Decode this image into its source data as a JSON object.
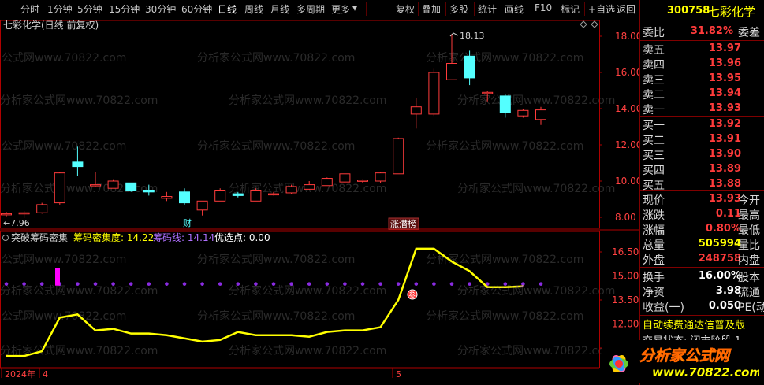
{
  "toolbar": {
    "left_items": [
      "分时",
      "1分钟",
      "5分钟",
      "15分钟",
      "30分钟",
      "60分钟",
      "日线",
      "周线",
      "月线",
      "多周期",
      "更多"
    ],
    "more_arrow": "▾",
    "active": "日线",
    "right_items": [
      "复权",
      "叠加",
      "多股",
      "统计",
      "画线",
      "F10",
      "标记",
      "+自选",
      "返回"
    ]
  },
  "chart": {
    "title": "七彩化学(日线 前复权)",
    "watermark": "分析家公式网www.70822.com",
    "price_axis": [
      "18.00",
      "16.00",
      "14.00",
      "12.00",
      "10.00",
      "8.00"
    ],
    "high_label": "18.13",
    "low_label": "7.96",
    "cai_badge": "财",
    "ztb_badge": "涨潜榜",
    "indicator": {
      "name": "突破筹码密集",
      "density_label": "筹码密集度:",
      "density_value": "14.22",
      "chip_label": "筹码线:",
      "chip_value": "14.14",
      "pick_label": "优选点:",
      "pick_value": "0.00",
      "axis": [
        "16.50",
        "15.00",
        "13.50",
        "12.00",
        "10.50"
      ],
      "signal_badge": "参"
    },
    "date_axis": [
      "2024年",
      "4",
      "5"
    ],
    "colors": {
      "up": "#ff3b3b",
      "down": "#54ffff",
      "border": "#b00000",
      "line": "#ffff00",
      "dots": "#8a2be2"
    },
    "chart_data": {
      "type": "candlestick",
      "ohlc": [
        [
          8.15,
          8.3,
          8.05,
          8.2
        ],
        [
          8.2,
          8.35,
          7.96,
          8.25
        ],
        [
          8.25,
          8.8,
          8.2,
          8.7
        ],
        [
          8.8,
          10.5,
          8.7,
          10.45
        ],
        [
          11.05,
          11.9,
          10.3,
          10.8
        ],
        [
          9.8,
          10.5,
          9.7,
          9.8
        ],
        [
          9.6,
          10.1,
          9.6,
          10.0
        ],
        [
          9.9,
          9.9,
          9.4,
          9.5
        ],
        [
          9.5,
          9.8,
          9.2,
          9.4
        ],
        [
          9.05,
          9.4,
          8.9,
          9.15
        ],
        [
          9.4,
          9.6,
          8.7,
          8.8
        ],
        [
          8.4,
          8.9,
          8.1,
          8.9
        ],
        [
          8.9,
          9.6,
          8.9,
          9.5
        ],
        [
          9.3,
          9.4,
          9.1,
          9.2
        ],
        [
          8.9,
          9.6,
          8.9,
          9.5
        ],
        [
          9.3,
          9.4,
          9.2,
          9.3
        ],
        [
          9.35,
          9.8,
          9.3,
          9.7
        ],
        [
          9.55,
          10.0,
          9.55,
          9.8
        ],
        [
          9.75,
          10.2,
          9.75,
          10.15
        ],
        [
          9.95,
          10.4,
          9.9,
          10.4
        ],
        [
          10.0,
          10.1,
          9.9,
          10.05
        ],
        [
          10.0,
          10.5,
          9.9,
          10.45
        ],
        [
          10.4,
          12.4,
          10.4,
          12.35
        ],
        [
          13.7,
          14.6,
          12.9,
          14.1
        ],
        [
          13.7,
          16.2,
          13.6,
          16.0
        ],
        [
          15.6,
          18.13,
          15.6,
          16.5
        ],
        [
          16.9,
          17.2,
          15.3,
          15.7
        ],
        [
          14.9,
          15.0,
          14.4,
          14.9
        ],
        [
          14.7,
          14.8,
          13.5,
          13.8
        ],
        [
          13.6,
          14.0,
          13.5,
          13.9
        ],
        [
          13.4,
          14.1,
          13.1,
          13.93
        ]
      ],
      "yellow_line": [
        10.0,
        10.0,
        10.3,
        12.4,
        12.6,
        11.6,
        11.7,
        11.4,
        11.4,
        11.3,
        11.1,
        10.9,
        11.0,
        11.5,
        11.3,
        11.3,
        11.3,
        11.2,
        11.5,
        11.6,
        11.6,
        11.8,
        13.5,
        16.7,
        16.7,
        15.9,
        15.3,
        14.3,
        14.3,
        14.35
      ],
      "dot_level": 14.5,
      "magenta_bar": {
        "index": 3,
        "low": 14.4,
        "high": 15.5
      }
    }
  },
  "quote": {
    "code": "300758",
    "name": "七彩化学",
    "weibi_label": "委比",
    "weibi_value": "31.82%",
    "weicha_label": "委差",
    "asks": [
      {
        "label": "卖五",
        "price": "13.97"
      },
      {
        "label": "卖四",
        "price": "13.96"
      },
      {
        "label": "卖三",
        "price": "13.95"
      },
      {
        "label": "卖二",
        "price": "13.94"
      },
      {
        "label": "卖一",
        "price": "13.93"
      }
    ],
    "bids": [
      {
        "label": "买一",
        "price": "13.92"
      },
      {
        "label": "买二",
        "price": "13.91"
      },
      {
        "label": "买三",
        "price": "13.90"
      },
      {
        "label": "买四",
        "price": "13.89"
      },
      {
        "label": "买五",
        "price": "13.88"
      }
    ],
    "stats": [
      {
        "label": "现价",
        "value": "13.93",
        "extra": "今开",
        "color": "red"
      },
      {
        "label": "涨跌",
        "value": "0.11",
        "extra": "最高",
        "color": "red"
      },
      {
        "label": "涨幅",
        "value": "0.80%",
        "extra": "最低",
        "color": "red"
      },
      {
        "label": "总量",
        "value": "505994",
        "extra": "量比",
        "color": "yellow"
      },
      {
        "label": "外盘",
        "value": "248758",
        "extra": "内盘",
        "color": "red"
      }
    ],
    "stats2": [
      {
        "label": "换手",
        "value": "16.00%",
        "extra": "股本",
        "color": "white"
      },
      {
        "label": "净资",
        "value": "3.98",
        "extra": "流通",
        "color": "white"
      },
      {
        "label": "收益(一)",
        "value": "0.050",
        "extra": "PE(动",
        "color": "white"
      }
    ],
    "marquee": "自动续费通达信普及版",
    "marquee2": "交易状态: 闭市阶段 1"
  },
  "logo": {
    "text": "分析家公式网",
    "url": "www.70822.com"
  }
}
